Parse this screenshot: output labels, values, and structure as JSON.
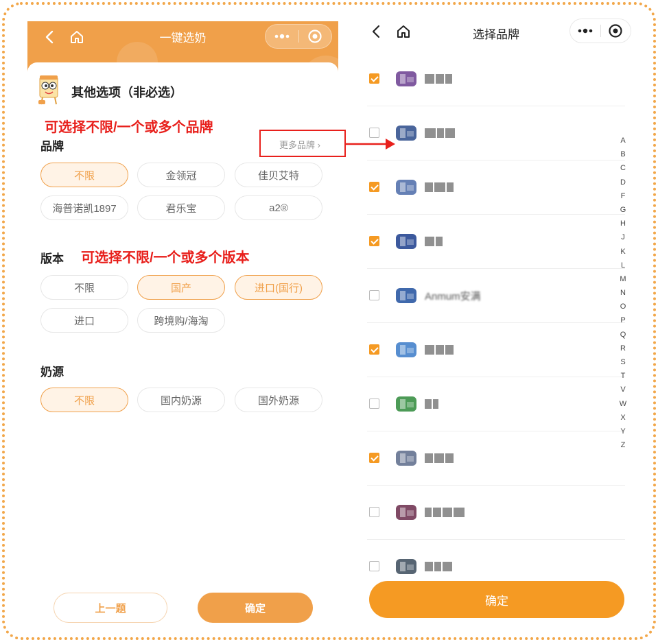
{
  "left": {
    "nav": {
      "title": "一键选奶"
    },
    "section_title": "其他选项（非必选）",
    "brand": {
      "annotation": "可选择不限/一个或多个品牌",
      "label": "品牌",
      "more": "更多品牌 ›",
      "options": [
        {
          "label": "不限",
          "selected": true
        },
        {
          "label": "金领冠",
          "selected": false
        },
        {
          "label": "佳贝艾特",
          "selected": false
        },
        {
          "label": "海普诺凯1897",
          "selected": false
        },
        {
          "label": "君乐宝",
          "selected": false
        },
        {
          "label": "a2®",
          "selected": false
        }
      ]
    },
    "version": {
      "label": "版本",
      "annotation": "可选择不限/一个或多个版本",
      "options": [
        {
          "label": "不限",
          "selected": false
        },
        {
          "label": "国产",
          "selected": true
        },
        {
          "label": "进口(国行)",
          "selected": true
        },
        {
          "label": "进口",
          "selected": false
        },
        {
          "label": "跨境购/海淘",
          "selected": false
        }
      ]
    },
    "source": {
      "label": "奶源",
      "options": [
        {
          "label": "不限",
          "selected": true
        },
        {
          "label": "国内奶源",
          "selected": false
        },
        {
          "label": "国外奶源",
          "selected": false
        }
      ]
    },
    "buttons": {
      "prev": "上一题",
      "confirm": "确定"
    }
  },
  "right": {
    "nav": {
      "title": "选择品牌"
    },
    "brands": [
      {
        "checked": true,
        "logo_color": "#6a3d8f"
      },
      {
        "checked": false,
        "logo_color": "#2a4a8a"
      },
      {
        "checked": true,
        "logo_color": "#4a6aa8"
      },
      {
        "checked": true,
        "logo_color": "#1a3c8c"
      },
      {
        "checked": false,
        "logo_color": "#1f4f9e",
        "name": "Anmum安满"
      },
      {
        "checked": true,
        "logo_color": "#3a7ac8"
      },
      {
        "checked": false,
        "logo_color": "#2e8a3a"
      },
      {
        "checked": true,
        "logo_color": "#5a6a8a"
      },
      {
        "checked": false,
        "logo_color": "#6a2a4a"
      },
      {
        "checked": false,
        "logo_color": "#3a4a5a"
      }
    ],
    "index_letters": [
      "A",
      "B",
      "C",
      "D",
      "F",
      "G",
      "H",
      "J",
      "K",
      "L",
      "M",
      "N",
      "O",
      "P",
      "Q",
      "R",
      "S",
      "T",
      "V",
      "W",
      "X",
      "Y",
      "Z"
    ],
    "confirm": "确定"
  },
  "colors": {
    "accent": "#f0a04a",
    "checkbox": "#f59a23",
    "annotation": "#e8201c"
  }
}
